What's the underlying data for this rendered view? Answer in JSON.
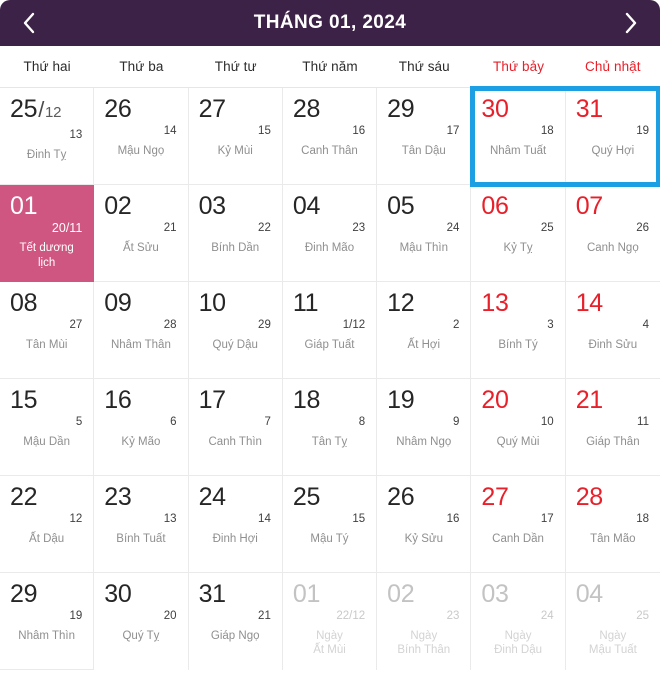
{
  "header": {
    "title": "THÁNG 01, 2024",
    "prev_icon": "chevron-left-icon",
    "next_icon": "chevron-right-icon"
  },
  "colors": {
    "header_bg": "#3c2246",
    "selected_bg": "#cf5680",
    "weekend_text": "#e8202a",
    "focus_ring": "#1c9fe3",
    "other_month_text": "#c3c3c3"
  },
  "weekdays": [
    {
      "label": "Thứ hai",
      "weekend": false
    },
    {
      "label": "Thứ ba",
      "weekend": false
    },
    {
      "label": "Thứ tư",
      "weekend": false
    },
    {
      "label": "Thứ năm",
      "weekend": false
    },
    {
      "label": "Thứ sáu",
      "weekend": false
    },
    {
      "label": "Thứ bảy",
      "weekend": true
    },
    {
      "label": "Chủ nhật",
      "weekend": true
    }
  ],
  "days": [
    {
      "solar": "25",
      "solar_month": "12",
      "lunar_num": "13",
      "lunar_name": "Đinh Tỵ",
      "weekend": false,
      "other": false,
      "selected": false
    },
    {
      "solar": "26",
      "lunar_num": "14",
      "lunar_name": "Mậu Ngọ",
      "weekend": false,
      "other": false,
      "selected": false
    },
    {
      "solar": "27",
      "lunar_num": "15",
      "lunar_name": "Kỷ Mùi",
      "weekend": false,
      "other": false,
      "selected": false
    },
    {
      "solar": "28",
      "lunar_num": "16",
      "lunar_name": "Canh Thân",
      "weekend": false,
      "other": false,
      "selected": false
    },
    {
      "solar": "29",
      "lunar_num": "17",
      "lunar_name": "Tân Dậu",
      "weekend": false,
      "other": false,
      "selected": false
    },
    {
      "solar": "30",
      "lunar_num": "18",
      "lunar_name": "Nhâm Tuất",
      "weekend": true,
      "other": false,
      "selected": false
    },
    {
      "solar": "31",
      "lunar_num": "19",
      "lunar_name": "Quý Hợi",
      "weekend": true,
      "other": false,
      "selected": false
    },
    {
      "solar": "01",
      "lunar_num": "20/11",
      "lunar_name": "Tết dương\nlịch",
      "weekend": false,
      "other": false,
      "selected": true
    },
    {
      "solar": "02",
      "lunar_num": "21",
      "lunar_name": "Ất Sửu",
      "weekend": false,
      "other": false,
      "selected": false
    },
    {
      "solar": "03",
      "lunar_num": "22",
      "lunar_name": "Bính Dần",
      "weekend": false,
      "other": false,
      "selected": false
    },
    {
      "solar": "04",
      "lunar_num": "23",
      "lunar_name": "Đinh Mão",
      "weekend": false,
      "other": false,
      "selected": false
    },
    {
      "solar": "05",
      "lunar_num": "24",
      "lunar_name": "Mậu Thìn",
      "weekend": false,
      "other": false,
      "selected": false
    },
    {
      "solar": "06",
      "lunar_num": "25",
      "lunar_name": "Kỷ Tỵ",
      "weekend": true,
      "other": false,
      "selected": false
    },
    {
      "solar": "07",
      "lunar_num": "26",
      "lunar_name": "Canh Ngọ",
      "weekend": true,
      "other": false,
      "selected": false
    },
    {
      "solar": "08",
      "lunar_num": "27",
      "lunar_name": "Tân Mùi",
      "weekend": false,
      "other": false,
      "selected": false
    },
    {
      "solar": "09",
      "lunar_num": "28",
      "lunar_name": "Nhâm Thân",
      "weekend": false,
      "other": false,
      "selected": false
    },
    {
      "solar": "10",
      "lunar_num": "29",
      "lunar_name": "Quý Dậu",
      "weekend": false,
      "other": false,
      "selected": false
    },
    {
      "solar": "11",
      "lunar_num": "1/12",
      "lunar_name": "Giáp Tuất",
      "weekend": false,
      "other": false,
      "selected": false
    },
    {
      "solar": "12",
      "lunar_num": "2",
      "lunar_name": "Ất Hợi",
      "weekend": false,
      "other": false,
      "selected": false
    },
    {
      "solar": "13",
      "lunar_num": "3",
      "lunar_name": "Bính Tý",
      "weekend": true,
      "other": false,
      "selected": false
    },
    {
      "solar": "14",
      "lunar_num": "4",
      "lunar_name": "Đinh Sửu",
      "weekend": true,
      "other": false,
      "selected": false
    },
    {
      "solar": "15",
      "lunar_num": "5",
      "lunar_name": "Mậu Dần",
      "weekend": false,
      "other": false,
      "selected": false
    },
    {
      "solar": "16",
      "lunar_num": "6",
      "lunar_name": "Kỷ Mão",
      "weekend": false,
      "other": false,
      "selected": false
    },
    {
      "solar": "17",
      "lunar_num": "7",
      "lunar_name": "Canh Thìn",
      "weekend": false,
      "other": false,
      "selected": false
    },
    {
      "solar": "18",
      "lunar_num": "8",
      "lunar_name": "Tân Tỵ",
      "weekend": false,
      "other": false,
      "selected": false
    },
    {
      "solar": "19",
      "lunar_num": "9",
      "lunar_name": "Nhâm Ngọ",
      "weekend": false,
      "other": false,
      "selected": false
    },
    {
      "solar": "20",
      "lunar_num": "10",
      "lunar_name": "Quý Mùi",
      "weekend": true,
      "other": false,
      "selected": false
    },
    {
      "solar": "21",
      "lunar_num": "11",
      "lunar_name": "Giáp Thân",
      "weekend": true,
      "other": false,
      "selected": false
    },
    {
      "solar": "22",
      "lunar_num": "12",
      "lunar_name": "Ất Dậu",
      "weekend": false,
      "other": false,
      "selected": false
    },
    {
      "solar": "23",
      "lunar_num": "13",
      "lunar_name": "Bính Tuất",
      "weekend": false,
      "other": false,
      "selected": false
    },
    {
      "solar": "24",
      "lunar_num": "14",
      "lunar_name": "Đinh Hợi",
      "weekend": false,
      "other": false,
      "selected": false
    },
    {
      "solar": "25",
      "lunar_num": "15",
      "lunar_name": "Mậu Tý",
      "weekend": false,
      "other": false,
      "selected": false
    },
    {
      "solar": "26",
      "lunar_num": "16",
      "lunar_name": "Kỷ Sửu",
      "weekend": false,
      "other": false,
      "selected": false
    },
    {
      "solar": "27",
      "lunar_num": "17",
      "lunar_name": "Canh Dần",
      "weekend": true,
      "other": false,
      "selected": false
    },
    {
      "solar": "28",
      "lunar_num": "18",
      "lunar_name": "Tân Mão",
      "weekend": true,
      "other": false,
      "selected": false
    },
    {
      "solar": "29",
      "lunar_num": "19",
      "lunar_name": "Nhâm Thìn",
      "weekend": false,
      "other": false,
      "selected": false
    },
    {
      "solar": "30",
      "lunar_num": "20",
      "lunar_name": "Quý Tỵ",
      "weekend": false,
      "other": false,
      "selected": false
    },
    {
      "solar": "31",
      "lunar_num": "21",
      "lunar_name": "Giáp Ngọ",
      "weekend": false,
      "other": false,
      "selected": false
    },
    {
      "solar": "01",
      "lunar_num": "22/12",
      "lunar_name": "Ngày\nẤt Mùi",
      "weekend": false,
      "other": true,
      "selected": false
    },
    {
      "solar": "02",
      "lunar_num": "23",
      "lunar_name": "Ngày\nBính Thân",
      "weekend": false,
      "other": true,
      "selected": false
    },
    {
      "solar": "03",
      "lunar_num": "24",
      "lunar_name": "Ngày\nĐinh Dậu",
      "weekend": true,
      "other": true,
      "selected": false
    },
    {
      "solar": "04",
      "lunar_num": "25",
      "lunar_name": "Ngày\nMậu Tuất",
      "weekend": true,
      "other": true,
      "selected": false
    }
  ],
  "focus_ring": {
    "present": true,
    "description": "blue-selection-ring-saturday-sunday-week1"
  }
}
